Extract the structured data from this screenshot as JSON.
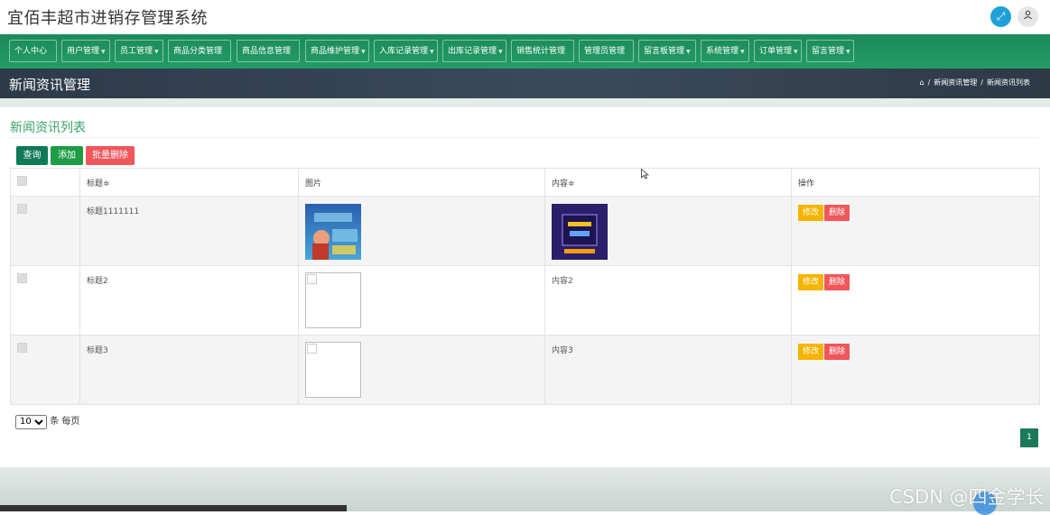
{
  "app": {
    "title": "宜佰丰超市进销存管理系统"
  },
  "nav": {
    "items": [
      {
        "label": "个人中心",
        "has_caret": false
      },
      {
        "label": "用户管理",
        "has_caret": true
      },
      {
        "label": "员工管理",
        "has_caret": true
      },
      {
        "label": "商品分类管理",
        "has_caret": false
      },
      {
        "label": "商品信息管理",
        "has_caret": false
      },
      {
        "label": "商品维护管理",
        "has_caret": true
      },
      {
        "label": "入库记录管理",
        "has_caret": true
      },
      {
        "label": "出库记录管理",
        "has_caret": true
      },
      {
        "label": "销售统计管理",
        "has_caret": false
      },
      {
        "label": "管理员管理",
        "has_caret": false
      },
      {
        "label": "留言板管理",
        "has_caret": true
      },
      {
        "label": "系统管理",
        "has_caret": true
      },
      {
        "label": "订单管理",
        "has_caret": true
      },
      {
        "label": "留言管理",
        "has_caret": true
      }
    ]
  },
  "header": {
    "page_title": "新闻资讯管理",
    "breadcrumb": [
      "新闻资讯管理",
      "新闻资讯列表"
    ],
    "breadcrumb_sep": "/"
  },
  "panel": {
    "title": "新闻资讯列表",
    "buttons": {
      "query": "查询",
      "add": "添加",
      "batch_delete": "批量删除"
    }
  },
  "table": {
    "columns": [
      "",
      "标题≑",
      "图片",
      "内容≑",
      "操作"
    ],
    "rows": [
      {
        "title": "标题1111111",
        "image": "photo-ocean",
        "content": "",
        "content_image": "photo-hlp"
      },
      {
        "title": "标题2",
        "image": "broken",
        "content": "内容2",
        "content_image": ""
      },
      {
        "title": "标题3",
        "image": "broken",
        "content": "内容3",
        "content_image": ""
      }
    ],
    "actions": {
      "edit": "修改",
      "delete": "删除"
    }
  },
  "pager": {
    "page_size": "10",
    "page_size_options": [
      "10"
    ],
    "per_page_text": "条 每页",
    "current_page": "1"
  },
  "watermark": "CSDN @四金学长",
  "colors": {
    "nav_green": "#1b8b5a",
    "title_band": "#2d3a4a",
    "accent_green": "#3aa36b",
    "edit_yellow": "#f5b400",
    "delete_red": "#f0565b"
  }
}
